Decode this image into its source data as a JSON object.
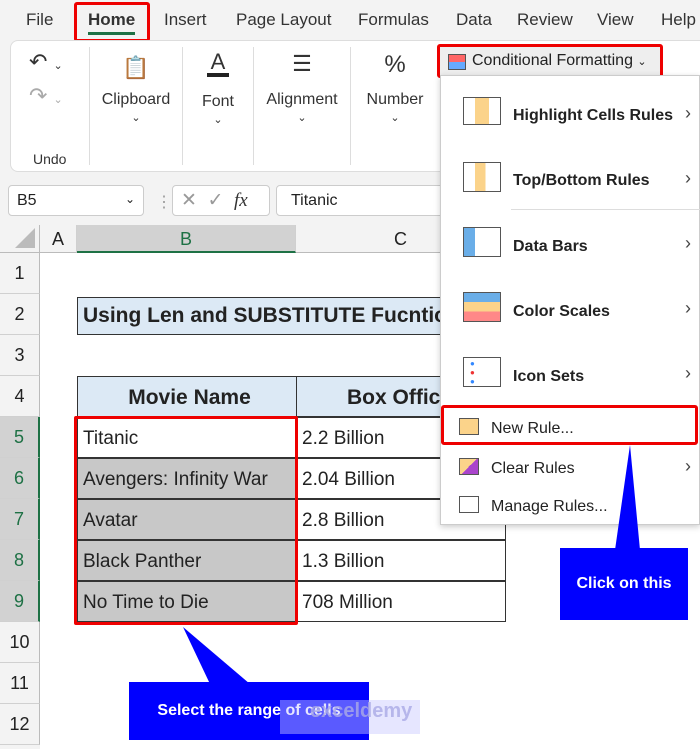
{
  "tabs": [
    "File",
    "Home",
    "Insert",
    "Page Layout",
    "Formulas",
    "Data",
    "Review",
    "View",
    "Help"
  ],
  "ribbon": {
    "undo": "Undo",
    "clipboard": "Clipboard",
    "font": "Font",
    "alignment": "Alignment",
    "number": "Number",
    "conditional_formatting": "Conditional Formatting"
  },
  "formula_bar": {
    "name_box": "B5",
    "fx": "fx",
    "value": "Titanic"
  },
  "columns": [
    "A",
    "B",
    "C"
  ],
  "rows": [
    "1",
    "2",
    "3",
    "4",
    "5",
    "6",
    "7",
    "8",
    "9",
    "10",
    "11",
    "12"
  ],
  "sheet": {
    "title": "Using Len and SUBSTITUTE Fucntion",
    "headers": [
      "Movie Name",
      "Box Office"
    ],
    "data": [
      [
        "Titanic",
        "2.2 Billion"
      ],
      [
        "Avengers: Infinity War",
        "2.04 Billion"
      ],
      [
        "Avatar",
        "2.8 Billion"
      ],
      [
        "Black Panther",
        "1.3 Billion"
      ],
      [
        "No Time to Die",
        "708 Million"
      ]
    ]
  },
  "menu": {
    "items": [
      "Highlight Cells Rules",
      "Top/Bottom Rules",
      "Data Bars",
      "Color Scales",
      "Icon Sets"
    ],
    "new_rule": "New Rule...",
    "clear_rules": "Clear Rules",
    "manage_rules": "Manage Rules..."
  },
  "callouts": {
    "click": "Click on this",
    "select": "Select the range of cells"
  },
  "watermark": "exceldemy EXCEL · DATA · BI"
}
